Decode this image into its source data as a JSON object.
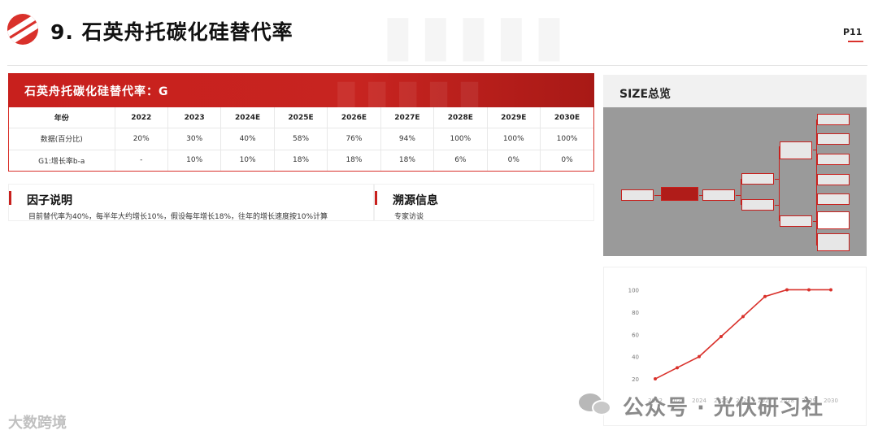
{
  "header": {
    "title": "9. 石英舟托碳化硅替代率",
    "page": "P11"
  },
  "banner": {
    "title": "石英舟托碳化硅替代率：G"
  },
  "table": {
    "header": [
      "年份",
      "2022",
      "2023",
      "2024E",
      "2025E",
      "2026E",
      "2027E",
      "2028E",
      "2029E",
      "2030E"
    ],
    "rows": [
      [
        "数据(百分比)",
        "20%",
        "30%",
        "40%",
        "58%",
        "76%",
        "94%",
        "100%",
        "100%",
        "100%"
      ],
      [
        "G1:增长率b-a",
        "-",
        "10%",
        "10%",
        "18%",
        "18%",
        "18%",
        "6%",
        "0%",
        "0%"
      ]
    ]
  },
  "factor": {
    "heading": "因子说明",
    "text": "目前替代率为40%，每半年大约增长10%，假设每年增长18%，往年的增长速度按10%计算"
  },
  "source": {
    "heading": "溯源信息",
    "text": "专家访谈"
  },
  "size_overview": {
    "title": "SIZE总览"
  },
  "chart_data": {
    "type": "line",
    "x": [
      "2022",
      "2023",
      "2024",
      "2025",
      "2026",
      "2027",
      "2028",
      "2029",
      "2030"
    ],
    "series": [
      {
        "values": [
          20,
          30,
          40,
          58,
          76,
          94,
          100,
          100,
          100
        ],
        "color": "#d9312b"
      }
    ],
    "y_ticks": [
      20,
      40,
      60,
      80,
      100
    ],
    "ylim": [
      12,
      104
    ],
    "grid": false
  },
  "watermarks": {
    "left": "大数跨境",
    "right": "公众号 · 光伏研习社"
  },
  "colors": {
    "accent": "#c8201d"
  }
}
